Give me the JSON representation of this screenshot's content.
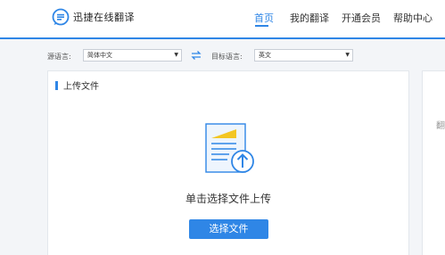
{
  "brand": {
    "name": "迅捷在线翻译"
  },
  "nav": {
    "items": [
      {
        "label": "首页",
        "active": true
      },
      {
        "label": "我的翻译",
        "active": false
      },
      {
        "label": "开通会员",
        "active": false
      },
      {
        "label": "帮助中心",
        "active": false
      }
    ]
  },
  "language": {
    "source_label": "源语言:",
    "source_value": "简体中文",
    "target_label": "目标语言:",
    "target_value": "英文"
  },
  "upload": {
    "section_title": "上传文件",
    "tip": "单击选择文件上传",
    "button_label": "选择文件"
  },
  "side": {
    "text": "翻"
  },
  "colors": {
    "accent": "#2f86e6",
    "illustration_yellow": "#f3c623"
  }
}
